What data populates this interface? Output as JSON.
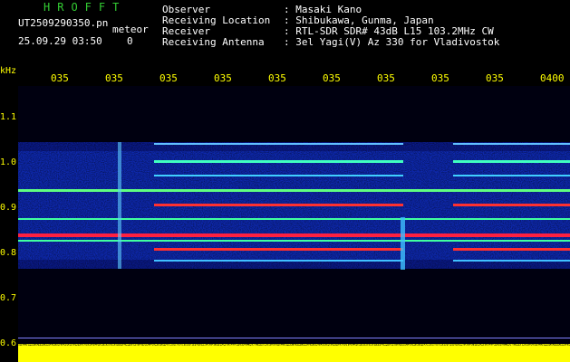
{
  "header": {
    "app_title": "HROFFT",
    "filename": "UT2509290350.pn",
    "tag": "meteor",
    "datetime": "25.09.29 03:50",
    "count": "0"
  },
  "station": [
    {
      "label": "Observer",
      "value": ": Masaki Kano"
    },
    {
      "label": "Receiving Location",
      "value": ": Shibukawa, Gunma, Japan"
    },
    {
      "label": "Receiver",
      "value": ": RTL-SDR SDR# 43dB L15 103.2MHz CW"
    },
    {
      "label": "Receiving Antenna",
      "value": ": 3el Yagi(V) Az 330 for Vladivostok"
    }
  ],
  "axis": {
    "unit": "kHz",
    "time_ticks": [
      "035",
      "035",
      "035",
      "035",
      "035",
      "035",
      "035",
      "035",
      "035",
      "0400"
    ],
    "freq_ticks": [
      "1.1",
      "1.0",
      "0.9",
      "0.8",
      "0.7",
      "0.6"
    ]
  },
  "colors": {
    "background": "#000000",
    "text": "#ffffff",
    "axis": "#ffff00",
    "title": "#33cc33",
    "signal_low": "#0000aa",
    "signal_mid": "#00ffaa",
    "signal_high": "#ff2020",
    "amplitude": "#ffff00"
  }
}
